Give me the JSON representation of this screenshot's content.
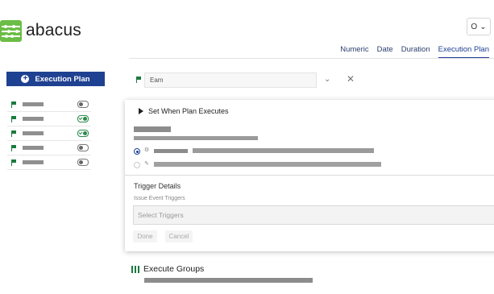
{
  "brand": {
    "name": "abacus",
    "color": "#6bbd45"
  },
  "user_menu": {
    "initial": "O",
    "chevron_icon": "chevron-down-icon"
  },
  "tabs": [
    {
      "label": "Numeric"
    },
    {
      "label": "Date"
    },
    {
      "label": "Duration"
    },
    {
      "label": "Execution Plan",
      "active": true
    }
  ],
  "sidebar": {
    "add_button_label": "Execution Plan",
    "add_button_icon": "plus-circle-icon",
    "items": [
      {
        "flag_icon": "flag-icon",
        "toggle_on": false
      },
      {
        "flag_icon": "flag-icon",
        "toggle_on": true
      },
      {
        "flag_icon": "flag-icon",
        "toggle_on": true
      },
      {
        "flag_icon": "flag-icon",
        "toggle_on": false
      },
      {
        "flag_icon": "flag-icon",
        "toggle_on": false
      }
    ]
  },
  "plan_editor": {
    "name_input_value": "Eam",
    "chevron_icon": "chevron-down-icon",
    "close_icon": "close-icon"
  },
  "panel": {
    "header": "Set When Plan Executes",
    "trigger_details_title": "Trigger Details",
    "issue_event_label": "Issue Event Triggers",
    "select_placeholder": "Select Triggers",
    "done_label": "Done",
    "cancel_label": "Cancel"
  },
  "execute_groups": {
    "title": "Execute Groups"
  },
  "colors": {
    "accent": "#1f4191",
    "flag": "#1a7a3d"
  }
}
